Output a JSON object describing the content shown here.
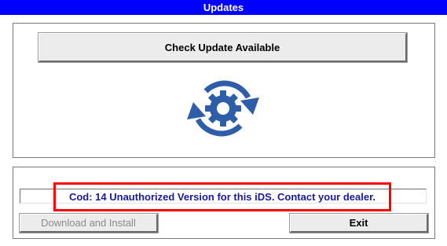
{
  "window": {
    "title": "Updates"
  },
  "top_panel": {
    "check_button_label": "Check Update Available",
    "icon": "refresh-gear-icon"
  },
  "bottom_panel": {
    "status_message": "Cod: 14 Unauthorized Version for this iDS. Contact your dealer.",
    "download_button_label": "Download and Install",
    "download_button_enabled": false,
    "exit_button_label": "Exit"
  },
  "colors": {
    "titlebar": "#0000ff",
    "titlebar_text": "#ffffff",
    "status_text": "#1a1a9c",
    "highlight_border": "#ff0000",
    "icon": "#2e5ea8"
  }
}
